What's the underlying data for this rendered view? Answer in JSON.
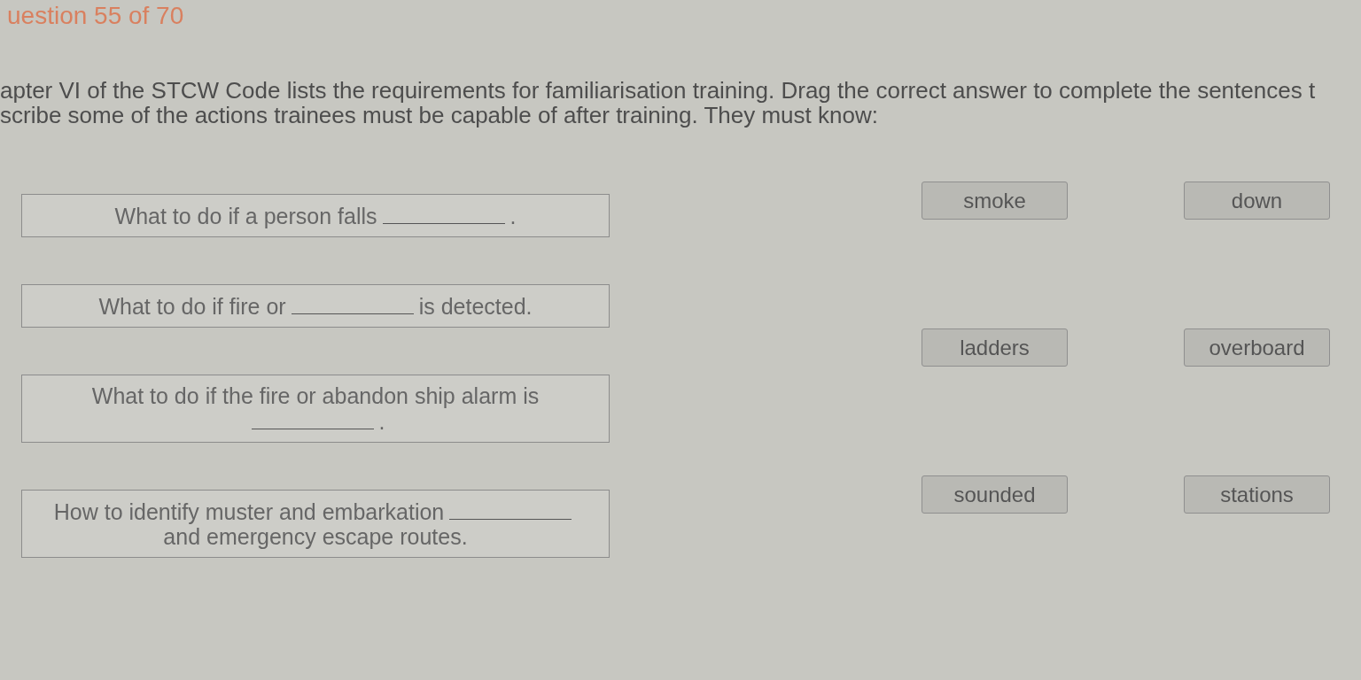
{
  "question_header": "uestion 55 of 70",
  "instruction_lines": [
    "apter VI of the STCW Code lists the requirements for familiarisation training. Drag the correct answer to complete the sentences t",
    "scribe some of the actions trainees must be capable of after training. They must know:"
  ],
  "sentences": [
    {
      "before": "What to do if a person falls",
      "after": "."
    },
    {
      "before": "What to do if fire or",
      "after": "is detected."
    },
    {
      "before": "What to do if the fire or abandon ship alarm is",
      "after": "."
    },
    {
      "before": "How to identify muster and embarkation",
      "after": "and emergency escape routes."
    }
  ],
  "answers": [
    "smoke",
    "down",
    "ladders",
    "overboard",
    "sounded",
    "stations"
  ]
}
